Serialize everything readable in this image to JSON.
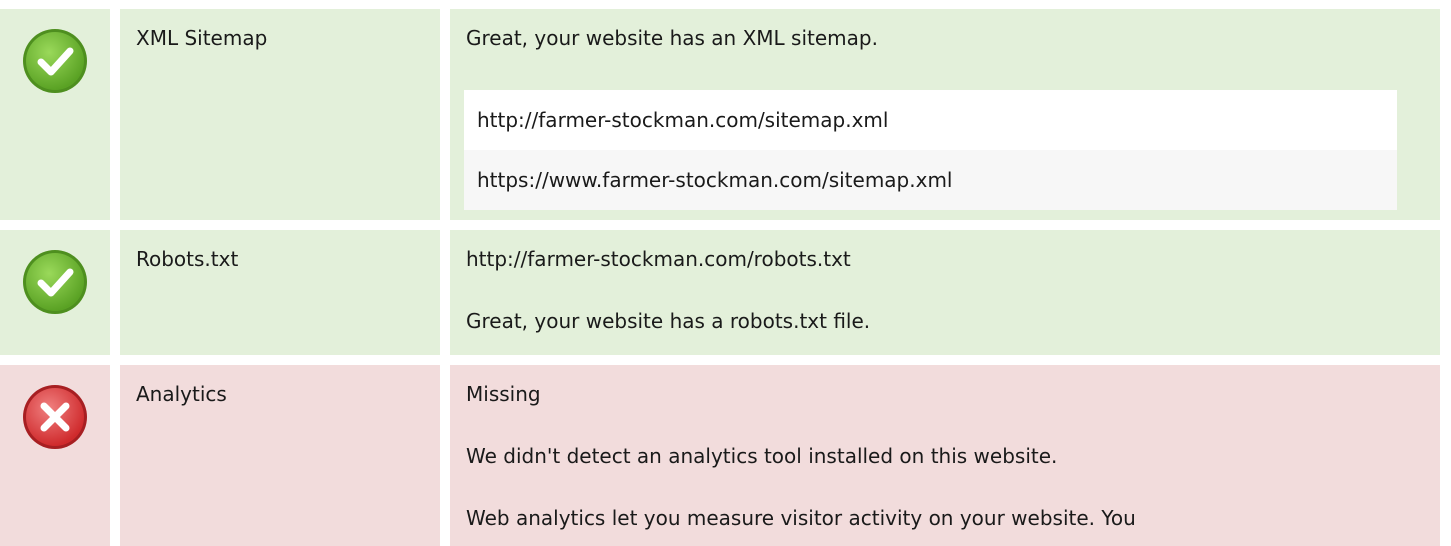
{
  "checks": [
    {
      "status": "pass",
      "icon": "check-circle-icon",
      "label": "XML Sitemap",
      "message": "Great, your website has an XML sitemap.",
      "urls": [
        "http://farmer-stockman.com/sitemap.xml",
        "https://www.farmer-stockman.com/sitemap.xml"
      ]
    },
    {
      "status": "pass",
      "icon": "check-circle-icon",
      "label": "Robots.txt",
      "url": "http://farmer-stockman.com/robots.txt",
      "message": "Great, your website has a robots.txt file."
    },
    {
      "status": "fail",
      "icon": "error-circle-icon",
      "label": "Analytics",
      "state": "Missing",
      "message": "We didn't detect an analytics tool installed on this website.",
      "description": "Web analytics let you measure visitor activity on your website. You"
    }
  ],
  "colors": {
    "pass_background": "#e3f0da",
    "fail_background": "#f2dcdc",
    "pass_icon": "#6ab42c",
    "fail_icon": "#d9393b"
  }
}
